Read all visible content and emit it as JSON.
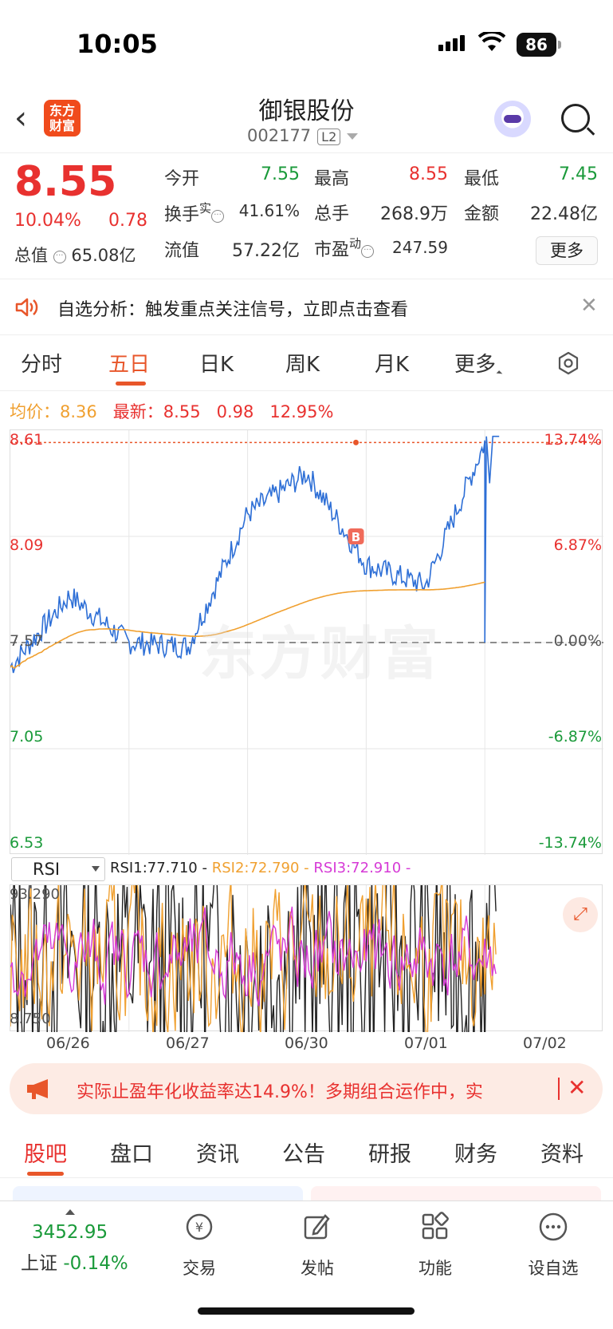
{
  "status": {
    "time": "10:05",
    "battery": "86"
  },
  "header": {
    "logo_line1": "东方",
    "logo_line2": "财富",
    "name": "御银股份",
    "code": "002177",
    "level": "L2"
  },
  "quote": {
    "price": "8.55",
    "pct": "10.04%",
    "change": "0.78",
    "total_value_label": "总值",
    "total_value": "65.08亿",
    "open_label": "今开",
    "open": "7.55",
    "high_label": "最高",
    "high": "8.55",
    "low_label": "最低",
    "low": "7.45",
    "turnover_label": "换手",
    "turnover_sup": "实",
    "turnover": "41.61%",
    "volume_label": "总手",
    "volume": "268.9万",
    "amount_label": "金额",
    "amount": "22.48亿",
    "float_label": "流值",
    "float": "57.22亿",
    "pe_label": "市盈",
    "pe_sup": "动",
    "pe": "247.59",
    "more": "更多",
    "colors": {
      "up": "#e8312f",
      "down": "#1a9a3a"
    }
  },
  "alert": {
    "text": "自选分析：触发重点关注信号，立即点击查看"
  },
  "tabs": [
    "分时",
    "五日",
    "日K",
    "周K",
    "月K",
    "更多"
  ],
  "active_tab": "五日",
  "avg_row": {
    "avg_label": "均价：",
    "avg": "8.36",
    "latest_label": "最新：",
    "latest": "8.55",
    "chg": "0.98",
    "pct": "12.95%"
  },
  "chart": {
    "left_axis": [
      "8.61",
      "8.09",
      "7.57",
      "7.05",
      "6.53"
    ],
    "right_axis": [
      "13.74%",
      "6.87%",
      "0.00%",
      "-6.87%",
      "-13.74%"
    ],
    "marker": "B",
    "watermark": "东方财富"
  },
  "rsi": {
    "indicator": "RSI",
    "rsi1": "RSI1:77.710 -",
    "rsi2": "RSI2:72.790 -",
    "rsi3": "RSI3:72.910 -",
    "max": "93.290",
    "min": "8.750"
  },
  "dates": [
    "06/26",
    "06/27",
    "06/30",
    "07/01",
    "07/02"
  ],
  "promo": {
    "text": "实际止盈年化收益率达14.9%！多期组合运作中，实"
  },
  "bottom_tabs": [
    "股吧",
    "盘口",
    "资讯",
    "公告",
    "研报",
    "财务",
    "资料"
  ],
  "dock": {
    "index_value": "3452.95",
    "index_name": "上证",
    "index_pct": "-0.14%",
    "items": [
      "交易",
      "发帖",
      "功能",
      "设自选"
    ]
  },
  "chart_data": {
    "type": "line",
    "x": [
      "06/26",
      "06/27",
      "06/30",
      "07/01",
      "07/02"
    ],
    "series": [
      {
        "name": "",
        "values": [
          7.45,
          7.8,
          7.57,
          7.55,
          8.2,
          8.4,
          7.95,
          7.85,
          8.55
        ]
      }
    ],
    "ylim": [
      6.53,
      8.61
    ]
  }
}
